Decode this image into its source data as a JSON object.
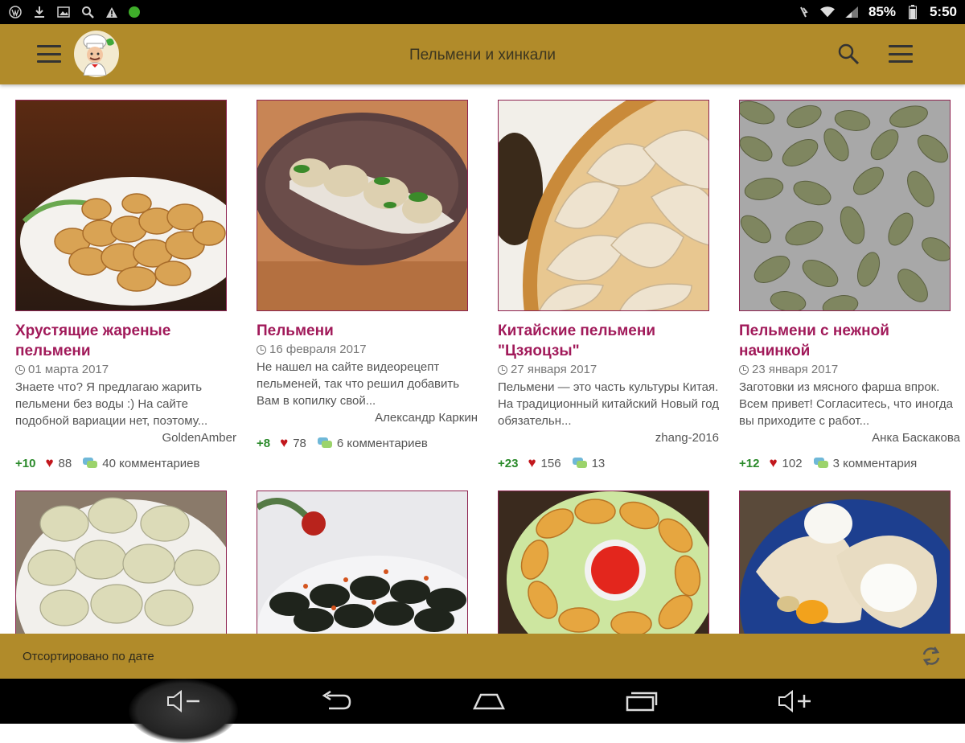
{
  "status_bar": {
    "battery": "85%",
    "time": "5:50"
  },
  "toolbar": {
    "title": "Пельмени и хинкали"
  },
  "recipes": [
    {
      "title": "Хрустящие жареные пельмени",
      "date": "01 марта 2017",
      "description": "Знаете что? Я предлагаю жарить пельмени без воды :) На сайте подобной вариации нет, поэтому...",
      "author": "GoldenAmber",
      "score": "+10",
      "likes": "88",
      "comments": "40 комментариев"
    },
    {
      "title": "Пельмени",
      "date": "16 февраля 2017",
      "description": "Не нашел на сайте видеорецепт пельменей, так что решил добавить Вам в копилку свой...",
      "author": "Александр Каркин",
      "score": "+8",
      "likes": "78",
      "comments": "6 комментариев"
    },
    {
      "title": "Китайские пельмени \"Цзяоцзы\"",
      "date": "27 января 2017",
      "description": "Пельмени — это часть культуры Китая. На традиционный китайский Новый год обязательн...",
      "author": "zhang-2016",
      "score": "+23",
      "likes": "156",
      "comments": "13"
    },
    {
      "title": "Пельмени с нежной начинкой",
      "date": "23 января 2017",
      "description": "Заготовки из мясного фарша впрок. Всем привет! Согласитесь, что иногда вы приходите с работ...",
      "author": "Анка Баскакова",
      "score": "+12",
      "likes": "102",
      "comments": "3 комментария"
    }
  ],
  "bottom_bar": {
    "sort_label": "Отсортировано по дате"
  },
  "colors": {
    "toolbar": "#b18b2a",
    "title_accent": "#a11a5a",
    "score_green": "#2a8a2a",
    "heart_red": "#c2171d"
  },
  "icons": [
    "menu-icon",
    "chef-logo",
    "search-icon",
    "overflow-menu-icon",
    "clock-icon",
    "heart-icon",
    "comments-icon",
    "refresh-icon",
    "volume-down-icon",
    "back-icon",
    "home-icon",
    "recents-icon",
    "volume-up-icon"
  ]
}
